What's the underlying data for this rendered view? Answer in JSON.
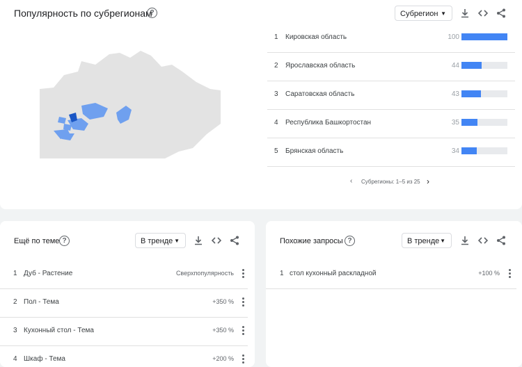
{
  "region_card": {
    "title": "Популярность по субрегионам",
    "select_value": "Субрегион",
    "rows": [
      {
        "rank": "1",
        "name": "Кировская область",
        "value": "100",
        "fill": 1.0
      },
      {
        "rank": "2",
        "name": "Ярославская область",
        "value": "44",
        "fill": 0.44
      },
      {
        "rank": "3",
        "name": "Саратовская область",
        "value": "43",
        "fill": 0.43
      },
      {
        "rank": "4",
        "name": "Республика Башкортостан",
        "value": "35",
        "fill": 0.35
      },
      {
        "rank": "5",
        "name": "Брянская область",
        "value": "34",
        "fill": 0.34
      }
    ],
    "pager": "Субрегионы: 1–5 из 25"
  },
  "topics_card": {
    "title": "Ещё по теме",
    "select_value": "В тренде",
    "rows": [
      {
        "rank": "1",
        "name": "Дуб - Растение",
        "value": "Сверхпопулярность"
      },
      {
        "rank": "2",
        "name": "Пол - Тема",
        "value": "+350 %"
      },
      {
        "rank": "3",
        "name": "Кухонный стол - Тема",
        "value": "+350 %"
      },
      {
        "rank": "4",
        "name": "Шкаф - Тема",
        "value": "+200 %"
      }
    ]
  },
  "queries_card": {
    "title": "Похожие запросы",
    "select_value": "В тренде",
    "rows": [
      {
        "rank": "1",
        "name": "стол кухонный раскладной",
        "value": "+100 %"
      }
    ]
  },
  "colors": {
    "accent": "#4285f4",
    "map_land": "#e3e3e3",
    "map_dark": "#1a56c5"
  }
}
